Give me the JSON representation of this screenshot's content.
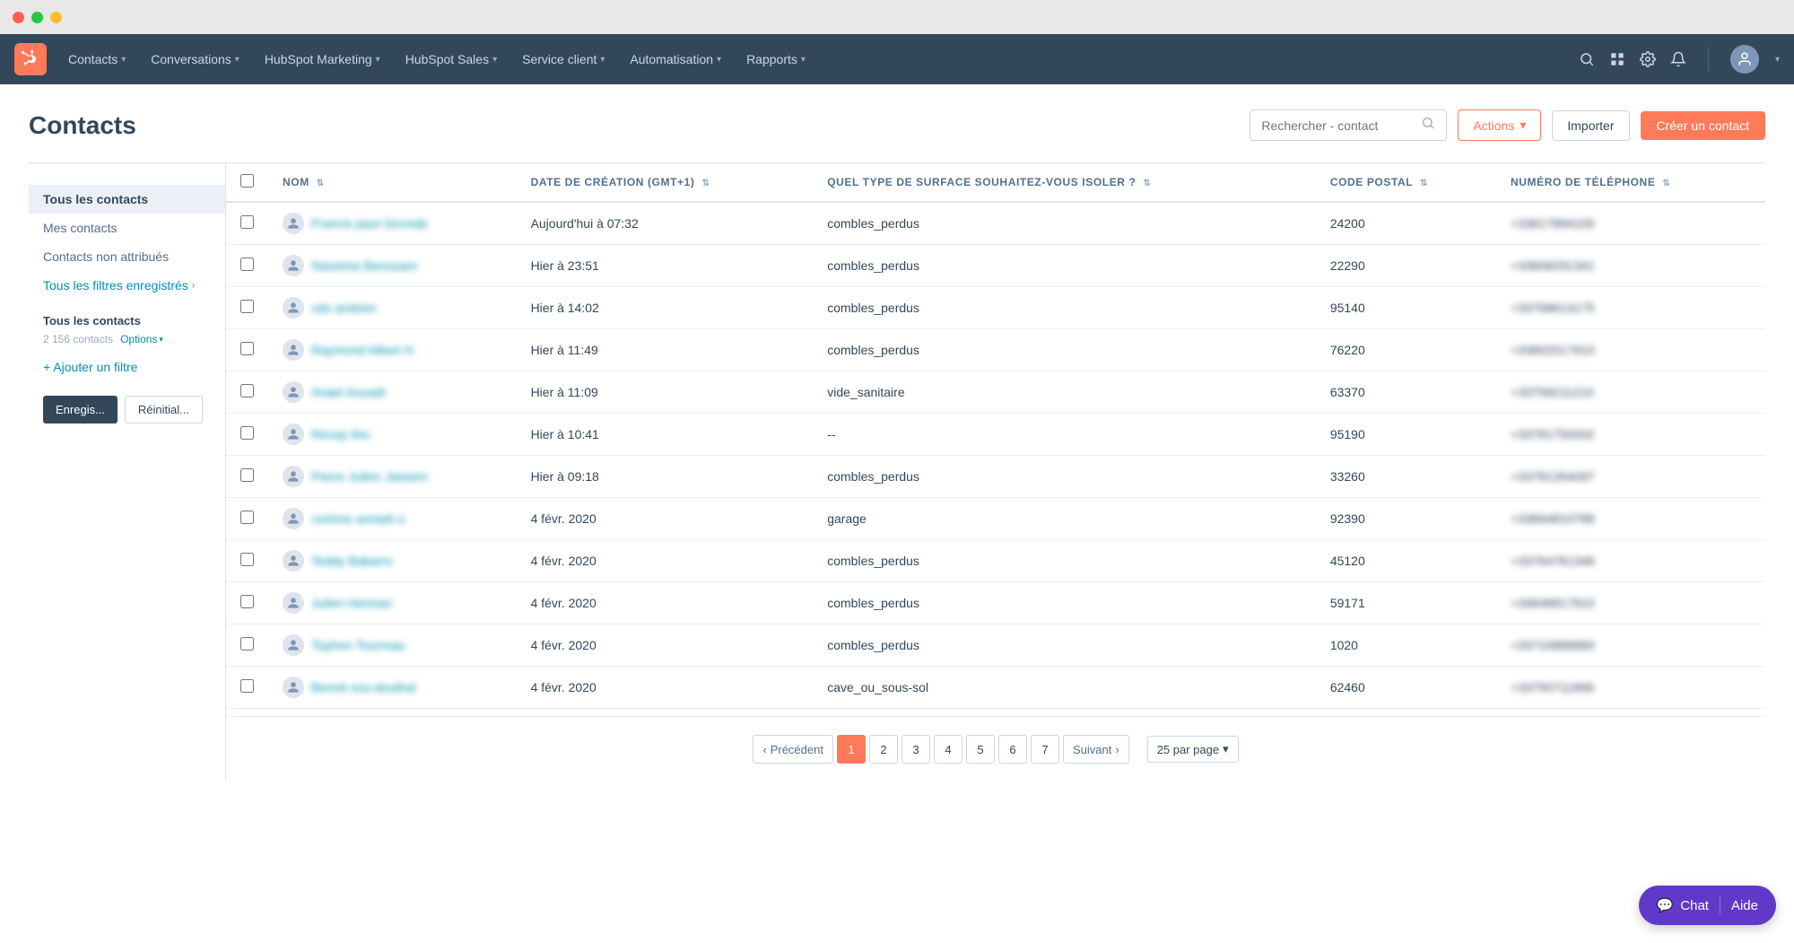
{
  "titlebar": {
    "dots": [
      "red",
      "green",
      "yellow"
    ]
  },
  "navbar": {
    "logo_label": "HubSpot",
    "items": [
      {
        "label": "Contacts",
        "has_chevron": true
      },
      {
        "label": "Conversations",
        "has_chevron": true
      },
      {
        "label": "HubSpot Marketing",
        "has_chevron": true
      },
      {
        "label": "HubSpot Sales",
        "has_chevron": true
      },
      {
        "label": "Service client",
        "has_chevron": true
      },
      {
        "label": "Automatisation",
        "has_chevron": true
      },
      {
        "label": "Rapports",
        "has_chevron": true
      }
    ]
  },
  "page": {
    "title": "Contacts",
    "search_placeholder": "Rechercher - contact",
    "actions_label": "Actions",
    "import_label": "Importer",
    "create_label": "Créer un contact"
  },
  "sidebar": {
    "items": [
      {
        "label": "Tous les contacts",
        "active": true
      },
      {
        "label": "Mes contacts",
        "active": false
      },
      {
        "label": "Contacts non attribués",
        "active": false
      }
    ],
    "saved_filters_label": "Tous les filtres enregistrés",
    "section_title": "Tous les contacts",
    "contact_count": "2 156 contacts",
    "options_label": "Options",
    "add_filter_label": "+ Ajouter un filtre",
    "save_btn": "Enregis...",
    "reset_btn": "Réinitial..."
  },
  "table": {
    "columns": [
      {
        "label": "NOM",
        "sortable": true
      },
      {
        "label": "DATE DE CRÉATION (GMT+1)",
        "sortable": true
      },
      {
        "label": "QUEL TYPE DE SURFACE SOUHAITEZ-VOUS ISOLER ?",
        "sortable": true
      },
      {
        "label": "CODE POSTAL",
        "sortable": true
      },
      {
        "label": "NUMÉRO DE TÉLÉPHONE",
        "sortable": true
      }
    ],
    "rows": [
      {
        "name": "Francis paul Gironde",
        "date": "Aujourd'hui à 07:32",
        "surface": "combles_perdus",
        "postal": "24200",
        "phone": "+33617894100"
      },
      {
        "name": "Nassima Benouam",
        "date": "Hier à 23:51",
        "surface": "combles_perdus",
        "postal": "22290",
        "phone": "+33608291341"
      },
      {
        "name": "cdo andrien",
        "date": "Hier à 14:02",
        "surface": "combles_perdus",
        "postal": "95140",
        "phone": "+33768614175"
      },
      {
        "name": "Raymond Albert H.",
        "date": "Hier à 11:49",
        "surface": "combles_perdus",
        "postal": "76220",
        "phone": "+33602517910"
      },
      {
        "name": "Anael Aouadi",
        "date": "Hier à 11:09",
        "surface": "vide_sanitaire",
        "postal": "63370",
        "phone": "+33758211210"
      },
      {
        "name": "Recep Ilnc",
        "date": "Hier à 10:41",
        "surface": "--",
        "postal": "95190",
        "phone": "+33781750002"
      },
      {
        "name": "Pierre Julien Jassem",
        "date": "Hier à 09:18",
        "surface": "combles_perdus",
        "postal": "33260",
        "phone": "+33781264097"
      },
      {
        "name": "corinne annadi o.",
        "date": "4 févr. 2020",
        "surface": "garage",
        "postal": "92390",
        "phone": "+33664810788"
      },
      {
        "name": "Teddy Babarro",
        "date": "4 févr. 2020",
        "surface": "combles_perdus",
        "postal": "45120",
        "phone": "+33764761346"
      },
      {
        "name": "Julien Herman",
        "date": "4 févr. 2020",
        "surface": "combles_perdus",
        "postal": "59171",
        "phone": "+33648817910"
      },
      {
        "name": "Tophon Tourreau",
        "date": "4 févr. 2020",
        "surface": "combles_perdus",
        "postal": "1020",
        "phone": "+33710886860"
      },
      {
        "name": "Benoit sou-douthal",
        "date": "4 févr. 2020",
        "surface": "cave_ou_sous-sol",
        "postal": "62460",
        "phone": "+33750711668"
      }
    ]
  },
  "pagination": {
    "prev_label": "Précédent",
    "next_label": "Suivant",
    "pages": [
      1,
      2,
      3,
      4,
      5,
      6,
      7
    ],
    "current_page": 1,
    "per_page_label": "25 par page"
  },
  "chat_widget": {
    "chat_label": "Chat",
    "help_label": "Aide"
  }
}
